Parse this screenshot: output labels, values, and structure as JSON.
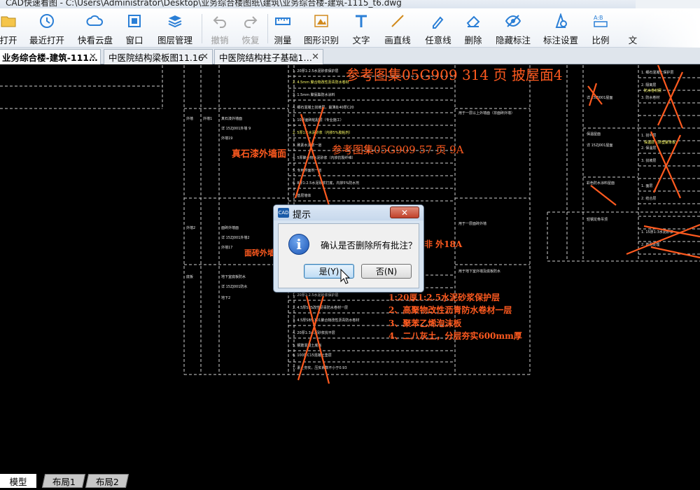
{
  "window": {
    "title": "CAD快速看图 - C:\\Users\\Administrator\\Desktop\\业务综合楼图纸\\建筑\\业务综合楼-建筑-1115_t6.dwg"
  },
  "toolbar": {
    "items": [
      {
        "label": "打开",
        "icon": "open-folder-icon",
        "enabled": true
      },
      {
        "label": "最近打开",
        "icon": "recent-open-icon",
        "enabled": true
      },
      {
        "label": "快看云盘",
        "icon": "cloud-icon",
        "enabled": true
      },
      {
        "label": "窗口",
        "icon": "window-icon",
        "enabled": true
      },
      {
        "label": "图层管理",
        "icon": "layers-icon",
        "enabled": true
      },
      {
        "label": "撤销",
        "icon": "undo-icon",
        "enabled": false
      },
      {
        "label": "恢复",
        "icon": "redo-icon",
        "enabled": false
      },
      {
        "label": "测量",
        "icon": "ruler-icon",
        "enabled": true
      },
      {
        "label": "图形识别",
        "icon": "shape-recognize-icon",
        "enabled": true
      },
      {
        "label": "文字",
        "icon": "text-icon",
        "enabled": true
      },
      {
        "label": "画直线",
        "icon": "line-icon",
        "enabled": true
      },
      {
        "label": "任意线",
        "icon": "freehand-icon",
        "enabled": true
      },
      {
        "label": "删除",
        "icon": "eraser-icon",
        "enabled": true
      },
      {
        "label": "隐藏标注",
        "icon": "hide-eye-icon",
        "enabled": true
      },
      {
        "label": "标注设置",
        "icon": "annotation-settings-icon",
        "enabled": true
      },
      {
        "label": "比例",
        "icon": "scale-icon",
        "enabled": true
      },
      {
        "label": "文",
        "icon": "more-icon",
        "enabled": true
      }
    ]
  },
  "tabs": [
    {
      "label": "业务综合楼-建筑-111…",
      "active": true
    },
    {
      "label": "中医院结构梁板图11.16",
      "active": false
    },
    {
      "label": "中医院结构柱子基础1…",
      "active": false
    }
  ],
  "drawing": {
    "annotations": [
      "参考图集05G909  314 页  披屋面4",
      "参考图集05G909  57 页  9A",
      "真石漆外墙面",
      "面砖外墙",
      "1:20厚1:2.5水泥砂浆保护层",
      "2、高聚物改性沥青防水卷材一层",
      "3、聚苯乙烯泡沫板",
      "4、二八灰土，分层夯实600mm厚",
      "非 外18A"
    ]
  },
  "dialog": {
    "title": "提示",
    "logo_text": "CAD",
    "close_label": "✕",
    "message": "确认是否删除所有批注？",
    "yes_label": "是(Y)",
    "no_label": "否(N)"
  },
  "layout_tabs": [
    "模型",
    "布局1",
    "布局2"
  ],
  "colors": {
    "annotation": "#ff5a1f",
    "drawing_line": "#d8d8d8",
    "drawing_text": "#ffff66"
  }
}
